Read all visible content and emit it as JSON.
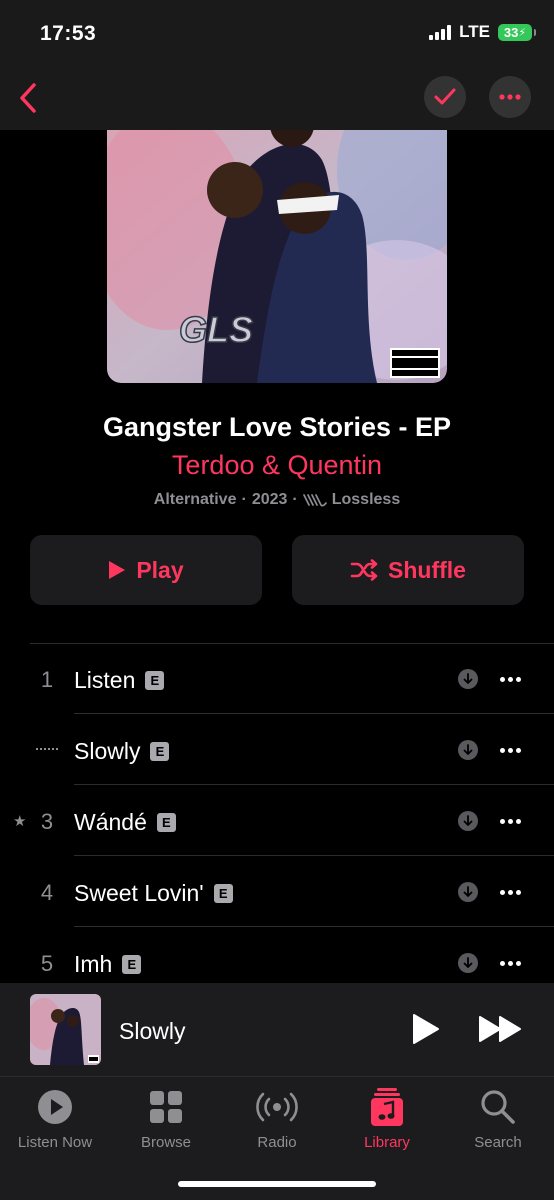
{
  "status": {
    "time": "17:53",
    "network": "LTE",
    "battery": "33"
  },
  "album": {
    "title": "Gangster Love Stories - EP",
    "artist": "Terdoo & Quentin",
    "genre": "Alternative",
    "year": "2023",
    "quality": "Lossless",
    "artwork_logo": "GLS",
    "artwork_advisory": "PARENTAL ADVISORY EXPLICIT CONTENT"
  },
  "actions": {
    "play_label": "Play",
    "shuffle_label": "Shuffle"
  },
  "tracks": [
    {
      "number": "1",
      "title": "Listen",
      "explicit": "E",
      "state": "normal"
    },
    {
      "number": "",
      "title": "Slowly",
      "explicit": "E",
      "state": "playing"
    },
    {
      "number": "3",
      "title": "Wándé",
      "explicit": "E",
      "state": "favorite"
    },
    {
      "number": "4",
      "title": "Sweet Lovin'",
      "explicit": "E",
      "state": "normal"
    },
    {
      "number": "5",
      "title": "Imh",
      "explicit": "E",
      "state": "normal"
    }
  ],
  "now_playing": {
    "title": "Slowly"
  },
  "tabs": [
    {
      "label": "Listen Now",
      "icon": "play-circle-icon",
      "active": false
    },
    {
      "label": "Browse",
      "icon": "grid-icon",
      "active": false
    },
    {
      "label": "Radio",
      "icon": "radio-waves-icon",
      "active": false
    },
    {
      "label": "Library",
      "icon": "music-note-icon",
      "active": true
    },
    {
      "label": "Search",
      "icon": "magnifier-icon",
      "active": false
    }
  ],
  "colors": {
    "accent": "#ff375f",
    "background": "#000000",
    "surface": "#1c1c1e",
    "secondary_text": "#8e8e93"
  }
}
